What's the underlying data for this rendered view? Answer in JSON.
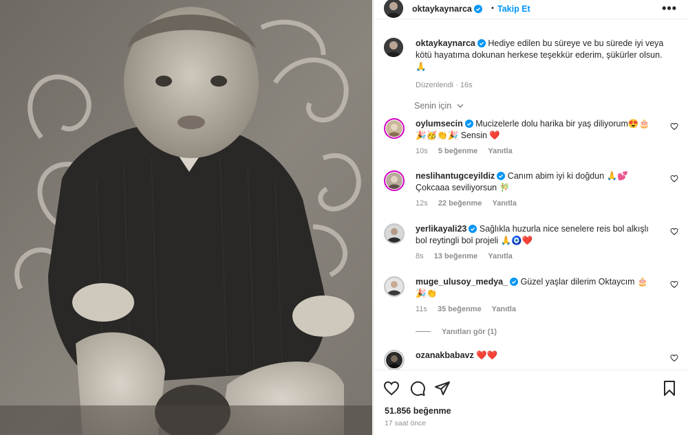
{
  "header": {
    "username": "oktaykaynarca",
    "dot": "•",
    "follow_label": "Takip Et",
    "more_label": "•••"
  },
  "caption": {
    "username": "oktaykaynarca",
    "text": "Hediye edilen bu süreye ve bu sürede iyi veya kötü hayatıma dokunan herkese teşekkür ederim, şükürler olsun.🙏",
    "edited_label": "Düzenlendi",
    "time": "16s"
  },
  "sort": {
    "label": "Senin için"
  },
  "comments": [
    {
      "username": "oylumsecin",
      "text": "Mucizelerle dolu harika bir yaş diliyorum😍🎂🎉🥳👏🎉 Sensin ❤️",
      "time": "10s",
      "likes": "5 beğenme",
      "reply": "Yanıtla"
    },
    {
      "username": "neslihantugceyildiz",
      "text": "Canım abim iyi ki doğdun 🙏💕 Çokcaaa seviliyorsun 🎋",
      "time": "12s",
      "likes": "22 beğenme",
      "reply": "Yanıtla"
    },
    {
      "username": "yerlikayali23",
      "text": "Sağlıkla huzurla nice senelere reis bol alkışlı bol reytingli bol projeli 🙏🧿❤️",
      "time": "8s",
      "likes": "13 beğenme",
      "reply": "Yanıtla"
    },
    {
      "username": "muge_ulusoy_medya_",
      "text": "Güzel yaşlar dilerim Oktaycım 🎂🎉👏",
      "time": "11s",
      "likes": "35 beğenme",
      "reply": "Yanıtla"
    },
    {
      "username": "ozanakbabavz",
      "text": "❤️❤️",
      "time": "",
      "likes": "",
      "reply": ""
    }
  ],
  "replies_label": "Yanıtları gör (1)",
  "footer": {
    "likes": "51.856 beğenme",
    "time": "17 saat önce"
  },
  "colors": {
    "link_blue": "#0095f6",
    "verified_blue": "#0095f6",
    "story_ring": "#d300c5",
    "meta_grey": "#8e8e8e"
  }
}
